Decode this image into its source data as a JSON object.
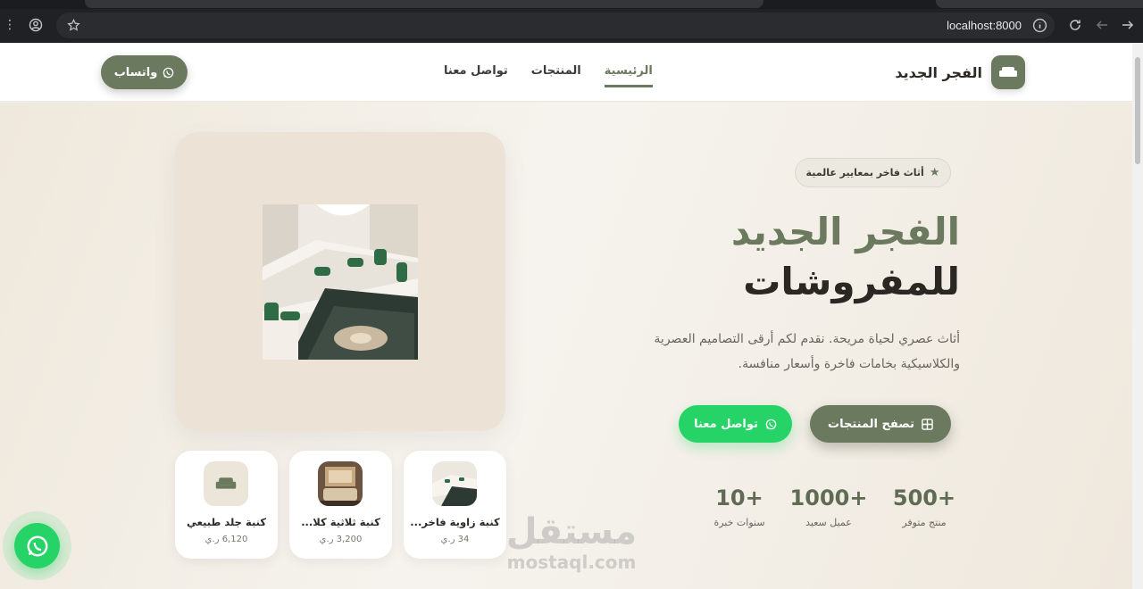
{
  "browser": {
    "url": "localhost:8000"
  },
  "header": {
    "brand_name": "الفجر الجديد",
    "nav": [
      "الرئيسية",
      "المنتجات",
      "تواصل معنا"
    ],
    "whatsapp_label": "واتساب"
  },
  "hero": {
    "badge": "أثاث فاخر بمعايير عالمية",
    "title_line1": "الفجر الجديد",
    "title_line2": "للمفروشات",
    "description": "أثاث عصري لحياة مريحة. نقدم لكم أرقى التصاميم العصرية والكلاسيكية بخامات فاخرة وأسعار منافسة.",
    "browse_button": "تصفح المنتجات",
    "contact_button": "تواصل معنا",
    "stats": [
      {
        "number": "+500",
        "label": "منتج متوفر"
      },
      {
        "number": "+1000",
        "label": "عميل سعيد"
      },
      {
        "number": "+10",
        "label": "سنوات خبرة"
      }
    ]
  },
  "products": [
    {
      "name": "كنبة زاوية فاخر...",
      "price": "34 ر.ي"
    },
    {
      "name": "كنبة ثلاثية كلا...",
      "price": "3,200 ر.ي"
    },
    {
      "name": "كنبة جلد طبيعي",
      "price": "6,120 ر.ي"
    }
  ],
  "watermark": {
    "arabic": "مستقل",
    "latin": "mostaql.com"
  },
  "colors": {
    "primary": "#6b7a5e",
    "whatsapp": "#25d366",
    "hero_bg": "#f3efe8"
  },
  "icons": {
    "brand": "sofa-icon",
    "whatsapp": "whatsapp-icon",
    "badge": "star-icon",
    "browse": "grid-icon"
  }
}
